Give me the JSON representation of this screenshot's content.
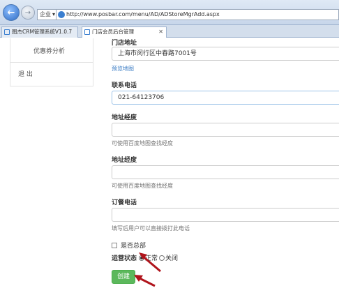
{
  "browser": {
    "mode_label": "企业",
    "url": "http://www.posbar.com/menu/AD/ADStoreMgrAdd.aspx",
    "tabs": [
      {
        "label": "图杰CRM管理系统V1.0.7"
      },
      {
        "label": "门店会员后台管理"
      }
    ]
  },
  "sidebar": {
    "items": [
      {
        "label": "优惠券分析"
      },
      {
        "label": "退 出"
      }
    ]
  },
  "form": {
    "address_label": "门店地址",
    "address_value": "上海市闵行区中春路7001号",
    "preview_map_link": "预览地图",
    "phone_label": "联系电话",
    "phone_value": "021-64123706",
    "lng_label": "地址经度",
    "lng_hint": "可使用百度地图查找经度",
    "lat_label": "地址经度",
    "lat_hint": "可使用百度地图查找经度",
    "order_phone_label": "订餐电话",
    "order_phone_hint": "填写后用户可以直接拨打此电话",
    "hq_checkbox_label": "是否总部",
    "status_label": "运营状态",
    "status_options": [
      {
        "label": "正常",
        "selected": true
      },
      {
        "label": "关闭",
        "selected": false
      }
    ],
    "create_button": "创建"
  },
  "colors": {
    "accent_green": "#5cb85c",
    "link_blue": "#3a7cc4",
    "annotation_red": "#b0141c"
  }
}
